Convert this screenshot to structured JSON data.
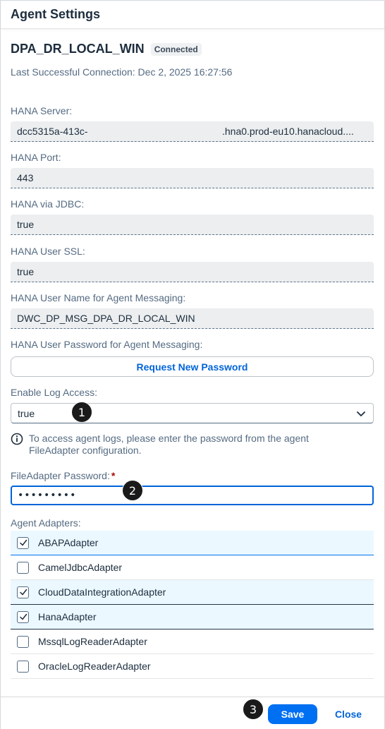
{
  "dialog": {
    "title": "Agent Settings"
  },
  "agent": {
    "name": "DPA_DR_LOCAL_WIN",
    "status": "Connected",
    "last_connection": "Last Successful Connection: Dec 2, 2025 16:27:56"
  },
  "fields": {
    "hana_server": {
      "label": "HANA Server:",
      "value_start": "dcc5315a-413c-",
      "value_end": ".hna0.prod-eu10.hanacloud...."
    },
    "hana_port": {
      "label": "HANA Port:",
      "value": "443"
    },
    "hana_jdbc": {
      "label": "HANA via JDBC:",
      "value": "true"
    },
    "hana_ssl": {
      "label": "HANA User SSL:",
      "value": "true"
    },
    "hana_user": {
      "label": "HANA User Name for Agent Messaging:",
      "value": "DWC_DP_MSG_DPA_DR_LOCAL_WIN"
    },
    "hana_password": {
      "label": "HANA User Password for Agent Messaging:",
      "button": "Request New Password"
    },
    "log_access": {
      "label": "Enable Log Access:",
      "value": "true"
    },
    "info": "To access agent logs, please enter the password from the agent FileAdapter configuration.",
    "file_adapter_password": {
      "label": "FileAdapter Password:",
      "required_mark": "*",
      "value": "•••••••••"
    }
  },
  "adapters": {
    "label": "Agent Adapters:",
    "items": [
      {
        "name": "ABAPAdapter",
        "checked": true
      },
      {
        "name": "CamelJdbcAdapter",
        "checked": false
      },
      {
        "name": "CloudDataIntegrationAdapter",
        "checked": true
      },
      {
        "name": "HanaAdapter",
        "checked": true
      },
      {
        "name": "MssqlLogReaderAdapter",
        "checked": false
      },
      {
        "name": "OracleLogReaderAdapter",
        "checked": false
      }
    ]
  },
  "footer": {
    "save": "Save",
    "close": "Close"
  },
  "markers": [
    "1",
    "2",
    "3"
  ],
  "icons": {
    "info": "info-circle-icon",
    "chevron": "chevron-down-icon",
    "check": "checkmark-icon"
  },
  "colors": {
    "accent": "#0070f2",
    "link": "#0064d9",
    "selected_row": "#ebf8ff",
    "required": "#aa0808"
  }
}
